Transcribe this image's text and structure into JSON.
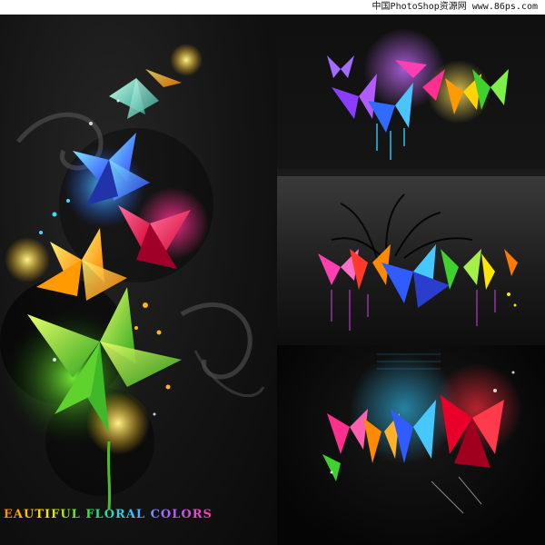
{
  "watermark": {
    "text": "中国PhotoShop资源网 www.86ps.com"
  },
  "caption": {
    "text": "EAUTIFUL FLORAL COLORS"
  },
  "panels": {
    "left": {
      "icon": "floral-bouquet-vertical"
    },
    "right_top": {
      "icon": "floral-bouquet-butterfly"
    },
    "right_middle": {
      "icon": "floral-bouquet-rainbow"
    },
    "right_bottom": {
      "icon": "floral-bouquet-neon"
    }
  },
  "palette": {
    "background": "#0b0b0b",
    "orange": "#ff8a00",
    "yellow": "#ffe600",
    "green": "#39e34a",
    "cyan": "#2fc9ff",
    "blue": "#3a5bff",
    "purple": "#b55bff",
    "magenta": "#ff2f8f",
    "red": "#ff2a3c"
  }
}
